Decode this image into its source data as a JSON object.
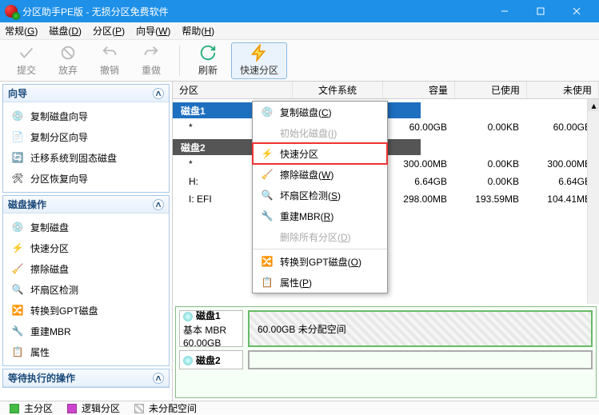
{
  "titlebar": {
    "title": "分区助手PE版 - 无损分区免费软件"
  },
  "menubar": {
    "items": [
      {
        "label": "常规",
        "accel": "G"
      },
      {
        "label": "磁盘",
        "accel": "D"
      },
      {
        "label": "分区",
        "accel": "P"
      },
      {
        "label": "向导",
        "accel": "W"
      },
      {
        "label": "帮助",
        "accel": "H"
      }
    ]
  },
  "toolbar": {
    "commit": "提交",
    "discard": "放弃",
    "undo": "撤销",
    "redo": "重做",
    "refresh": "刷新",
    "quick": "快速分区"
  },
  "sidebar": {
    "wizard": {
      "title": "向导",
      "items": [
        {
          "icon": "copy-disk-icon",
          "label": "复制磁盘向导"
        },
        {
          "icon": "copy-part-icon",
          "label": "复制分区向导"
        },
        {
          "icon": "migrate-ssd-icon",
          "label": "迁移系统到固态磁盘"
        },
        {
          "icon": "part-recover-icon",
          "label": "分区恢复向导"
        }
      ]
    },
    "diskops": {
      "title": "磁盘操作",
      "items": [
        {
          "icon": "copy-disk-icon",
          "label": "复制磁盘"
        },
        {
          "icon": "quick-part-icon",
          "label": "快速分区"
        },
        {
          "icon": "wipe-disk-icon",
          "label": "擦除磁盘"
        },
        {
          "icon": "bad-sector-icon",
          "label": "坏扇区检测"
        },
        {
          "icon": "gpt-icon",
          "label": "转换到GPT磁盘"
        },
        {
          "icon": "rebuild-mbr-icon",
          "label": "重建MBR"
        },
        {
          "icon": "properties-icon",
          "label": "属性"
        }
      ]
    },
    "pending": {
      "title": "等待执行的操作"
    }
  },
  "columns": {
    "partition": "分区",
    "filesystem": "文件系统",
    "capacity": "容量",
    "used": "已使用",
    "unused": "未使用"
  },
  "disks": [
    {
      "name": "磁盘1",
      "rows": [
        {
          "part": "*",
          "cap": "60.00GB",
          "used": "0.00KB",
          "unused": "60.00GB"
        }
      ]
    },
    {
      "name": "磁盘2",
      "rows": [
        {
          "part": "*",
          "cap": "300.00MB",
          "used": "0.00KB",
          "unused": "300.00MB"
        },
        {
          "part": "H:",
          "cap": "6.64GB",
          "used": "0.00KB",
          "unused": "6.64GB"
        },
        {
          "part": "I: EFI",
          "cap": "298.00MB",
          "used": "193.59MB",
          "unused": "104.41MB"
        }
      ]
    }
  ],
  "context_menu": [
    {
      "icon": "copy-disk-icon",
      "label_pre": "复制磁盘(",
      "accel": "C",
      "label_post": ")"
    },
    {
      "icon": "",
      "label_pre": "初始化磁盘(",
      "accel": "I",
      "label_post": ")",
      "disabled": true
    },
    {
      "icon": "quick-part-icon",
      "label_pre": "快速分区",
      "highlight": true
    },
    {
      "icon": "wipe-disk-icon",
      "label_pre": "擦除磁盘(",
      "accel": "W",
      "label_post": ")"
    },
    {
      "icon": "bad-sector-icon",
      "label_pre": "坏扇区检测(",
      "accel": "S",
      "label_post": ")"
    },
    {
      "icon": "rebuild-mbr-icon",
      "label_pre": "重建MBR(",
      "accel": "R",
      "label_post": ")"
    },
    {
      "icon": "",
      "label_pre": "删除所有分区(",
      "accel": "D",
      "label_post": ")",
      "disabled": true
    },
    {
      "sep": true
    },
    {
      "icon": "gpt-icon",
      "label_pre": "转换到GPT磁盘(",
      "accel": "O",
      "label_post": ")"
    },
    {
      "icon": "",
      "label_pre": "属性(",
      "accel": "P",
      "label_post": ")"
    }
  ],
  "viewer": {
    "disk1": {
      "name": "磁盘1",
      "sub1": "基本 MBR",
      "sub2": "60.00GB",
      "seg": "60.00GB 未分配空间"
    },
    "disk2": {
      "name": "磁盘2"
    }
  },
  "legend": {
    "primary": "主分区",
    "logical": "逻辑分区",
    "unalloc": "未分配空间"
  }
}
